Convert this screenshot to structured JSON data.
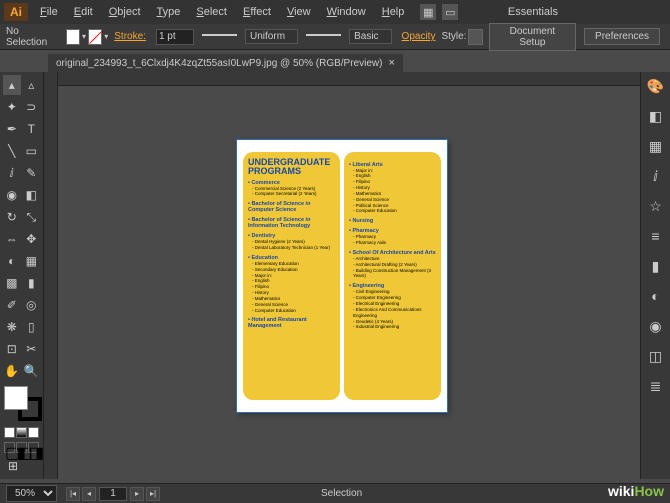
{
  "app": {
    "logo": "Ai",
    "workspace": "Essentials"
  },
  "menu": [
    "File",
    "Edit",
    "Object",
    "Type",
    "Select",
    "Effect",
    "View",
    "Window",
    "Help"
  ],
  "control": {
    "selection": "No Selection",
    "stroke_label": "Stroke:",
    "stroke_weight": "1 pt",
    "uniform": "Uniform",
    "basic": "Basic",
    "opacity": "Opacity",
    "style": "Style:",
    "doc_setup": "Document Setup",
    "prefs": "Preferences"
  },
  "tab": {
    "title": "original_234993_t_6Clxdj4K4zqZt55asI0LwP9.jpg @ 50% (RGB/Preview)",
    "close": "×"
  },
  "status": {
    "zoom": "50%",
    "artboard": "1",
    "mode": "Selection"
  },
  "doc": {
    "title1": "UNDERGRADUATE",
    "title2": "PROGRAMS",
    "left": [
      {
        "h": "Commerce",
        "items": [
          "Commercial Science (2 Years)",
          "Computer Secretarial (2 Years)"
        ]
      },
      {
        "h": "Bachelor of Science in Computer Science",
        "items": []
      },
      {
        "h": "Bachelor of Science in Information Technology",
        "items": []
      },
      {
        "h": "Dentistry",
        "items": [
          "Dental Hygiene (2 Years)",
          "Dental Laboratory Technician (1 Year)"
        ]
      },
      {
        "h": "Education",
        "items": [
          "Elementary Education",
          "Secondary Education",
          "Major in:",
          "  English",
          "  Filipino",
          "  History",
          "  Mathematics",
          "  General Science",
          "  Computer Education"
        ]
      },
      {
        "h": "Hotel and Restaurant Management",
        "items": []
      }
    ],
    "right": [
      {
        "h": "Liberal Arts",
        "items": [
          "Major in:",
          "  English",
          "  Filipino",
          "  History",
          "  Mathematics",
          "  General Science",
          "  Political Science",
          "  Computer Education"
        ]
      },
      {
        "h": "Nursing",
        "items": []
      },
      {
        "h": "Pharmacy",
        "items": [
          "Pharmacy",
          "Pharmacy Aide"
        ]
      },
      {
        "h": "School Of Architecture and Arts",
        "items": [
          "Architecture",
          "Architectural Drafting (2 Years)",
          "Building Construction Management (3 Years)"
        ]
      },
      {
        "h": "Engineering",
        "items": [
          "Civil Engineering",
          "Computer Engineering",
          "Electrical Engineering",
          "Electronics And Communications Engineering",
          "Geodetic (4 Years)",
          "Industrial Engineering"
        ]
      }
    ]
  },
  "watermark": {
    "wiki": "wiki",
    "how": "How"
  }
}
